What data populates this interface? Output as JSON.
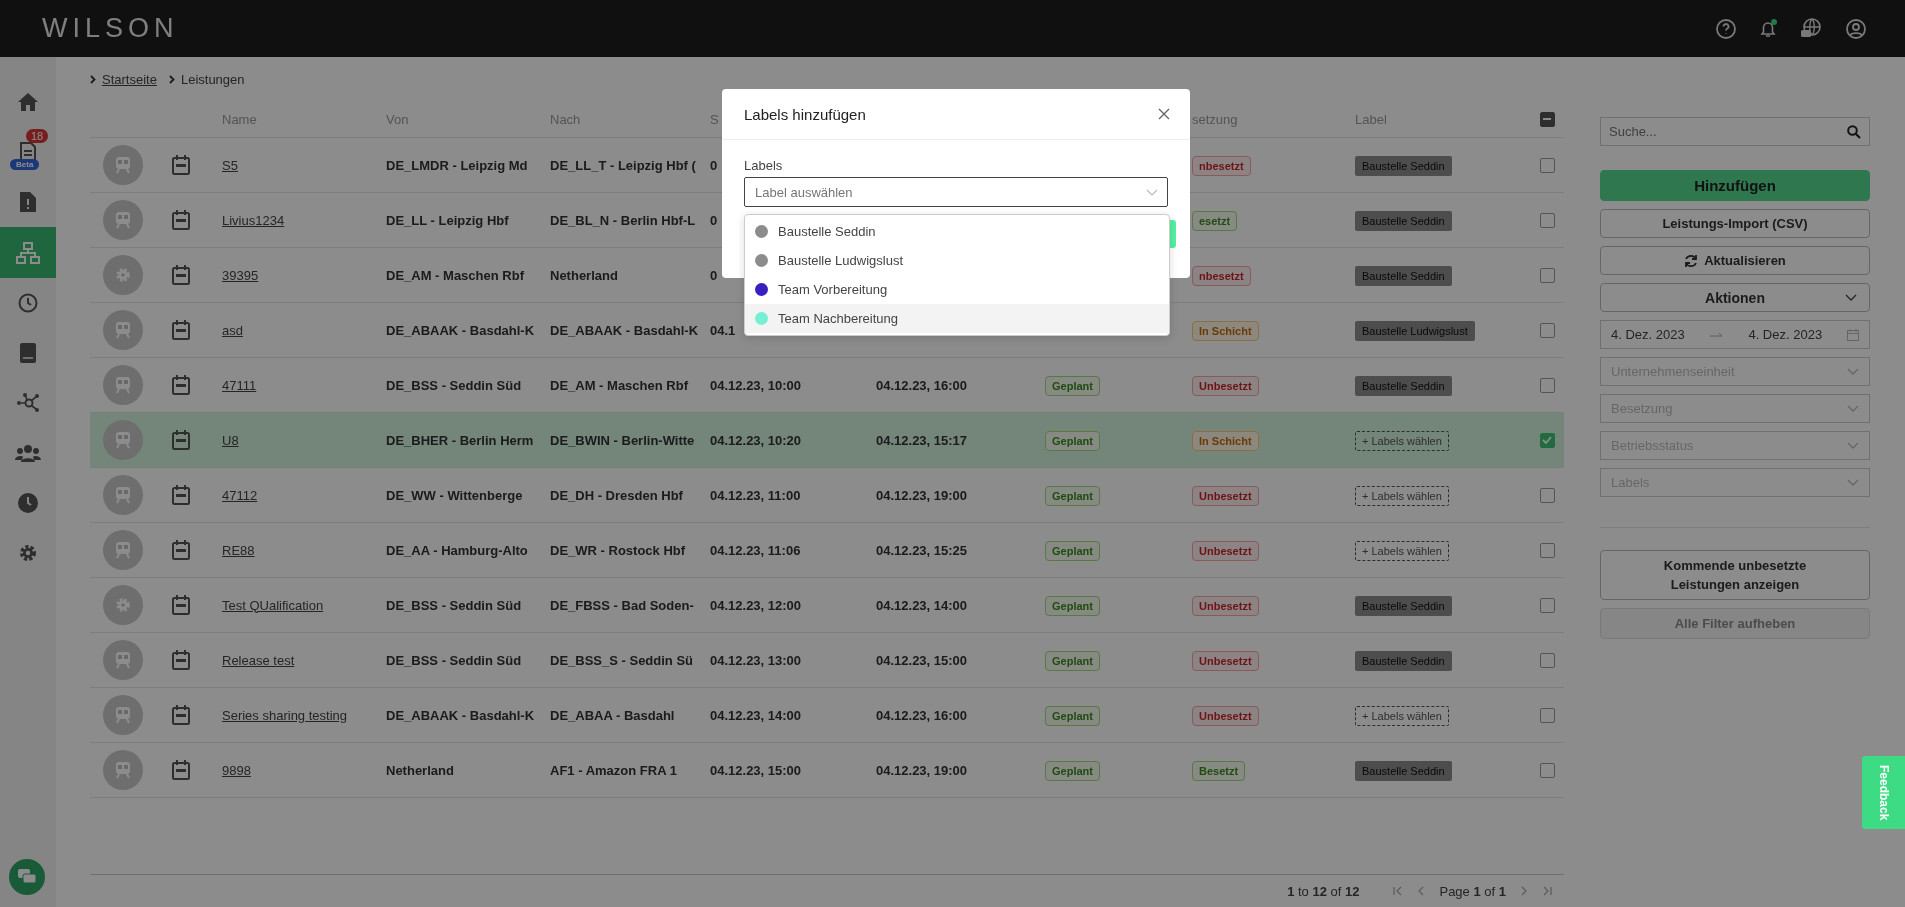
{
  "topbar": {
    "logo": "WILSON",
    "notification_dot": true
  },
  "sidebar": {
    "items": [
      {
        "selected": false
      },
      {
        "selected": false,
        "count": "18",
        "tag": "Beta"
      },
      {
        "selected": false
      },
      {
        "selected": true
      },
      {
        "selected": false
      },
      {
        "selected": false
      },
      {
        "selected": false
      },
      {
        "selected": false
      },
      {
        "selected": false
      },
      {
        "selected": false
      }
    ]
  },
  "breadcrumb": [
    {
      "label": "Startseite",
      "link": true
    },
    {
      "label": "Leistungen",
      "link": false
    }
  ],
  "table": {
    "header": {
      "name": "Name",
      "von": "Von",
      "nach": "Nach",
      "start": "S",
      "besetzung": "setzung",
      "label": "Label",
      "indeterminate": true
    },
    "rows": [
      {
        "kind": "train",
        "name": "S5",
        "von": "DE_LMDR - Leipzig Md",
        "nach": "DE_LL_T - Leipzig Hbf (",
        "start": "0",
        "besetzung": {
          "text": "nbesetzt",
          "kind": "unbesetzt"
        },
        "label": {
          "text": "Baustelle Seddin",
          "kind": "tag"
        },
        "selected": false
      },
      {
        "kind": "train",
        "name": "Livius1234",
        "von": "DE_LL - Leipzig Hbf",
        "nach": "DE_BL_N - Berlin Hbf-L",
        "start": "0",
        "besetzung": {
          "text": "esetzt",
          "kind": "besetzt"
        },
        "label": {
          "text": "Baustelle Seddin",
          "kind": "tag"
        },
        "selected": false
      },
      {
        "kind": "gear",
        "name": "39395",
        "von": "DE_AM - Maschen Rbf",
        "nach": "Netherland",
        "start": "0",
        "besetzung": {
          "text": "nbesetzt",
          "kind": "unbesetzt"
        },
        "label": {
          "text": "Baustelle Seddin",
          "kind": "tag"
        },
        "selected": false
      },
      {
        "kind": "train",
        "name": "asd",
        "von": "DE_ABAAK - Basdahl-K",
        "nach": "DE_ABAAK - Basdahl-K",
        "start": "04.1",
        "besetzung": {
          "text": "In Schicht",
          "kind": "schicht"
        },
        "label": {
          "text": "Baustelle Ludwigslust",
          "kind": "tag"
        },
        "selected": false
      },
      {
        "kind": "train",
        "name": "47111",
        "von": "DE_BSS - Seddin Süd",
        "nach": "DE_AM - Maschen Rbf",
        "start": "04.12.23, 10:00",
        "end": "04.12.23, 16:00",
        "status": "Geplant",
        "besetzung": {
          "text": "Unbesetzt",
          "kind": "unbesetzt"
        },
        "label": {
          "text": "Baustelle Seddin",
          "kind": "tag"
        },
        "selected": false
      },
      {
        "kind": "train",
        "name": "U8",
        "von": "DE_BHER - Berlin Herm",
        "nach": "DE_BWIN - Berlin-Witte",
        "start": "04.12.23, 10:20",
        "end": "04.12.23, 15:17",
        "status": "Geplant",
        "besetzung": {
          "text": "In Schicht",
          "kind": "schicht"
        },
        "label": {
          "text": "+ Labels wählen",
          "kind": "add"
        },
        "selected": true
      },
      {
        "kind": "train",
        "name": "47112",
        "von": "DE_WW - Wittenberge",
        "nach": "DE_DH - Dresden Hbf",
        "start": "04.12.23, 11:00",
        "end": "04.12.23, 19:00",
        "status": "Geplant",
        "besetzung": {
          "text": "Unbesetzt",
          "kind": "unbesetzt"
        },
        "label": {
          "text": "+ Labels wählen",
          "kind": "add"
        },
        "selected": false
      },
      {
        "kind": "train",
        "name": "RE88",
        "von": "DE_AA - Hamburg-Alto",
        "nach": "DE_WR - Rostock Hbf",
        "start": "04.12.23, 11:06",
        "end": "04.12.23, 15:25",
        "status": "Geplant",
        "besetzung": {
          "text": "Unbesetzt",
          "kind": "unbesetzt"
        },
        "label": {
          "text": "+ Labels wählen",
          "kind": "add"
        },
        "selected": false
      },
      {
        "kind": "gear",
        "name": "Test QUalification",
        "von": "DE_BSS - Seddin Süd",
        "nach": "DE_FBSS - Bad Soden-",
        "start": "04.12.23, 12:00",
        "end": "04.12.23, 14:00",
        "status": "Geplant",
        "besetzung": {
          "text": "Unbesetzt",
          "kind": "unbesetzt"
        },
        "label": {
          "text": "Baustelle Seddin",
          "kind": "tag"
        },
        "selected": false
      },
      {
        "kind": "train",
        "name": "Release test",
        "von": "DE_BSS - Seddin Süd",
        "nach": "DE_BSS_S - Seddin Sü",
        "start": "04.12.23, 13:00",
        "end": "04.12.23, 15:00",
        "status": "Geplant",
        "besetzung": {
          "text": "Unbesetzt",
          "kind": "unbesetzt"
        },
        "label": {
          "text": "Baustelle Seddin",
          "kind": "tag"
        },
        "selected": false
      },
      {
        "kind": "train",
        "name": "Series sharing testing",
        "von": "DE_ABAAK - Basdahl-K",
        "nach": "DE_ABAA - Basdahl",
        "start": "04.12.23, 14:00",
        "end": "04.12.23, 16:00",
        "status": "Geplant",
        "besetzung": {
          "text": "Unbesetzt",
          "kind": "unbesetzt"
        },
        "label": {
          "text": "+ Labels wählen",
          "kind": "add"
        },
        "selected": false
      },
      {
        "kind": "train",
        "name": "9898",
        "von": "Netherland",
        "nach": "AF1 - Amazon FRA 1",
        "start": "04.12.23, 15:00",
        "end": "04.12.23, 19:00",
        "status": "Geplant",
        "besetzung": {
          "text": "Besetzt",
          "kind": "besetzt"
        },
        "label": {
          "text": "Baustelle Seddin",
          "kind": "tag"
        },
        "selected": false
      }
    ]
  },
  "pagination": {
    "range": "**1** to **12** of **12**",
    "page": "Page **1** of **1**"
  },
  "panel": {
    "search": {
      "placeholder": "Suche..."
    },
    "buttons": [
      {
        "label": "Hinzufügen",
        "kind": "primary"
      },
      {
        "label": "Leistungs-Import (CSV)",
        "kind": "default"
      },
      {
        "label": "Aktualisieren",
        "kind": "refresh"
      },
      {
        "label": "Aktionen",
        "kind": "menu"
      }
    ],
    "date_range": {
      "from": "4. Dez. 2023",
      "to": "4. Dez. 2023"
    },
    "filters": [
      {
        "placeholder": "Unternehmenseinheit"
      },
      {
        "placeholder": "Besetzung"
      },
      {
        "placeholder": "Betriebsstatus"
      },
      {
        "placeholder": "Labels"
      }
    ],
    "actions": [
      {
        "label": "Kommende unbesetzte Leistungen anzeigen",
        "disabled": false
      },
      {
        "label": "Alle Filter aufheben",
        "disabled": true
      }
    ]
  },
  "modal": {
    "title": "Labels hinzufügen",
    "field_label": "Labels",
    "placeholder": "Label auswählen",
    "options": [
      {
        "label": "Baustelle Seddin",
        "color": "#8c8c8c",
        "highlighted": false
      },
      {
        "label": "Baustelle Ludwigslust",
        "color": "#8c8c8c",
        "highlighted": false
      },
      {
        "label": "Team Vorbereitung",
        "color": "#3a1fc0",
        "highlighted": false
      },
      {
        "label": "Team Nachbereitung",
        "color": "#76f0d4",
        "highlighted": true
      }
    ]
  },
  "feedback": {
    "label": "Feedback"
  }
}
